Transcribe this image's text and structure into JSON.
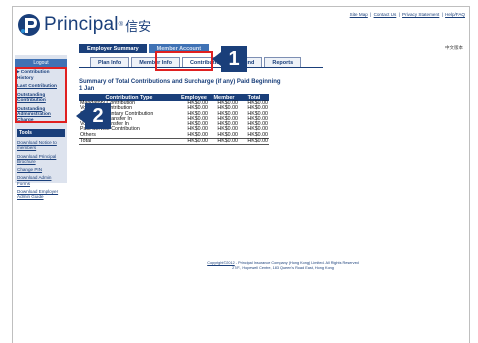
{
  "brand": {
    "name": "Principal",
    "cjk": "信安",
    "primary_color": "#1a3f7a",
    "accent_color": "#3f72b5"
  },
  "top_links": [
    "Site Map",
    "Contact Us",
    "Privacy Statement",
    "Help/FAQ"
  ],
  "language": "中文版本",
  "main_menu": [
    {
      "label": "Employer Summary",
      "active": false
    },
    {
      "label": "Member Account",
      "active": true
    }
  ],
  "subtabs": [
    {
      "label": "Plan Info",
      "active": false
    },
    {
      "label": "Member Info",
      "active": false
    },
    {
      "label": "Contribution",
      "active": true
    },
    {
      "label": "Fund",
      "active": false
    },
    {
      "label": "Reports",
      "active": false
    }
  ],
  "callouts": [
    "1",
    "2"
  ],
  "sidebar": {
    "logout": "Logout",
    "items": [
      {
        "label": "▸ Contribution History",
        "link": false
      },
      {
        "label": "Last Contribution",
        "link": true
      },
      {
        "label": "Outstanding Contribution",
        "link": true
      },
      {
        "label": "Outstanding Administration Charge",
        "link": true
      }
    ],
    "tools_title": "Tools",
    "tools": [
      "Download Notice to members",
      "Download Principal Brochure",
      "Change PIN",
      "Download Admin Forms",
      "Download Employer Admin Guide"
    ]
  },
  "summary": {
    "title": "Summary of Total Contributions and Surcharge (if any) Paid Beginning",
    "title_line2": "1 Jan",
    "columns": [
      "Contribution Type",
      "Employee",
      "Member",
      "Total"
    ],
    "rows": [
      {
        "type": "Mandatory Contribution",
        "employee": "HK$0.00",
        "member": "HK$0.00",
        "total": "HK$0.00"
      },
      {
        "type": "Voluntary Contribution",
        "employee": "HK$0.00",
        "member": "HK$0.00",
        "total": "HK$0.00"
      },
      {
        "type": "Optional Voluntary Contribution",
        "employee": "HK$0.00",
        "member": "HK$0.00",
        "total": "HK$0.00"
      },
      {
        "type": "Mandatory Transfer In",
        "employee": "HK$0.00",
        "member": "HK$0.00",
        "total": "HK$0.00"
      },
      {
        "type": "Voluntary Transfer In",
        "employee": "HK$0.00",
        "member": "HK$0.00",
        "total": "HK$0.00"
      },
      {
        "type": "Past Service Contribution",
        "employee": "HK$0.00",
        "member": "HK$0.00",
        "total": "HK$0.00"
      },
      {
        "type": "Others",
        "employee": "HK$0.00",
        "member": "HK$0.00",
        "total": "HK$0.00"
      }
    ],
    "total_row": {
      "type": "Total",
      "employee": "HK$0.00",
      "member": "HK$0.00",
      "total": "HK$0.00"
    }
  },
  "footer": {
    "copyright_link": "Copyright©2012",
    "line1": " - Principal Insurance Company (Hong Kong) Limited. All Rights Reserved",
    "line2": "27/F., Hopewell Centre, 183 Queen's Road East, Hong Kong"
  }
}
